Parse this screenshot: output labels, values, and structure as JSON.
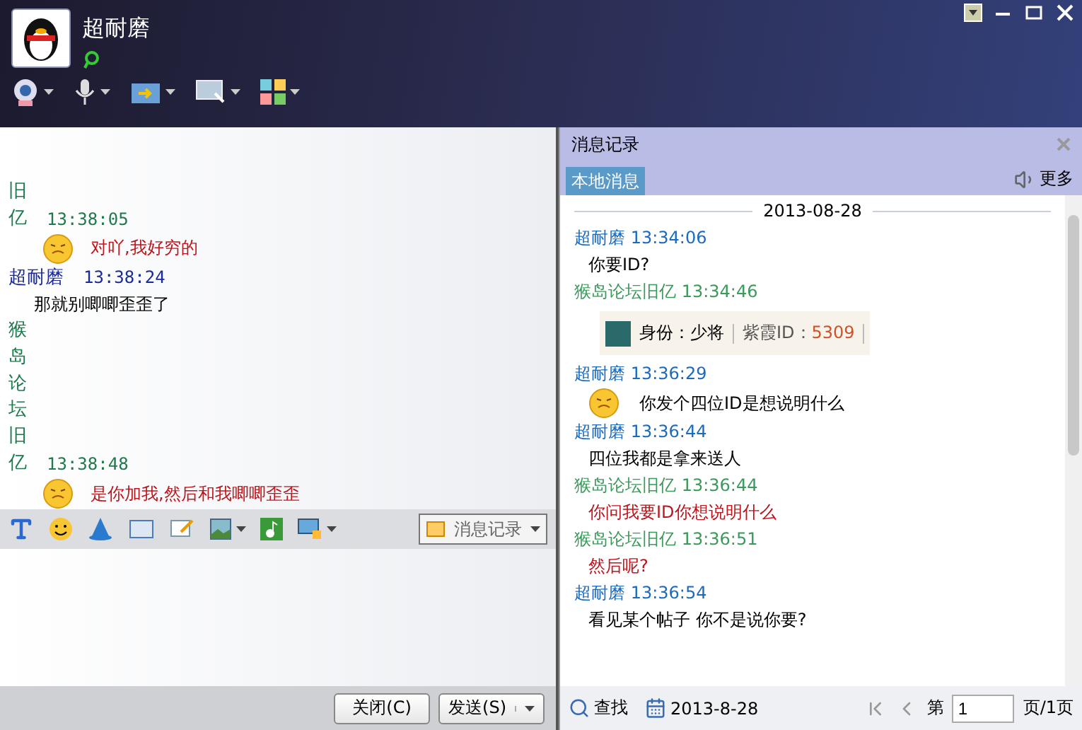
{
  "header": {
    "contact_name": "超耐磨"
  },
  "chat": [
    {
      "kind": "peer",
      "sender": "旧亿",
      "time": "13:38:05",
      "emoji": true,
      "text": "对吖,我好穷的"
    },
    {
      "kind": "self",
      "sender": "超耐磨",
      "time": "13:38:24",
      "text": "那就别唧唧歪歪了"
    },
    {
      "kind": "peer",
      "sender": "猴岛论坛旧亿",
      "time": "13:38:48",
      "emoji": true,
      "text": "是你加我,然后和我唧唧歪歪"
    }
  ],
  "input": {
    "history_button": "消息记录"
  },
  "buttons": {
    "close": "关闭(C)",
    "send": "发送(S)"
  },
  "history": {
    "title": "消息记录",
    "tabs": [
      {
        "label": "本地消息",
        "selected": true
      }
    ],
    "more": "更多",
    "date": "2013-08-28",
    "entries": [
      {
        "kind": "self",
        "sender": "超耐磨",
        "time": "13:34:06",
        "text": "你要ID?"
      },
      {
        "kind": "peer",
        "sender": "猴岛论坛旧亿",
        "time": "13:34:46",
        "card": {
          "rank_label": "身份：少将",
          "id_label": "紫霞ID：",
          "id_value": "5309"
        }
      },
      {
        "kind": "self",
        "sender": "超耐磨",
        "time": "13:36:29",
        "emoji": true,
        "text": "你发个四位ID是想说明什么"
      },
      {
        "kind": "self",
        "sender": "超耐磨",
        "time": "13:36:44",
        "text": "四位我都是拿来送人"
      },
      {
        "kind": "peer",
        "sender": "猴岛论坛旧亿",
        "time": "13:36:44",
        "text": "你问我要ID你想说明什么"
      },
      {
        "kind": "peer",
        "sender": "猴岛论坛旧亿",
        "time": "13:36:51",
        "text": "然后呢?"
      },
      {
        "kind": "self",
        "sender": "超耐磨",
        "time": "13:36:54",
        "text": "看见某个帖子      你不是说你要?"
      }
    ],
    "footer": {
      "search": "查找",
      "date": "2013-8-28",
      "page_prefix": "第",
      "page": "1",
      "page_suffix": "页/1页"
    }
  }
}
